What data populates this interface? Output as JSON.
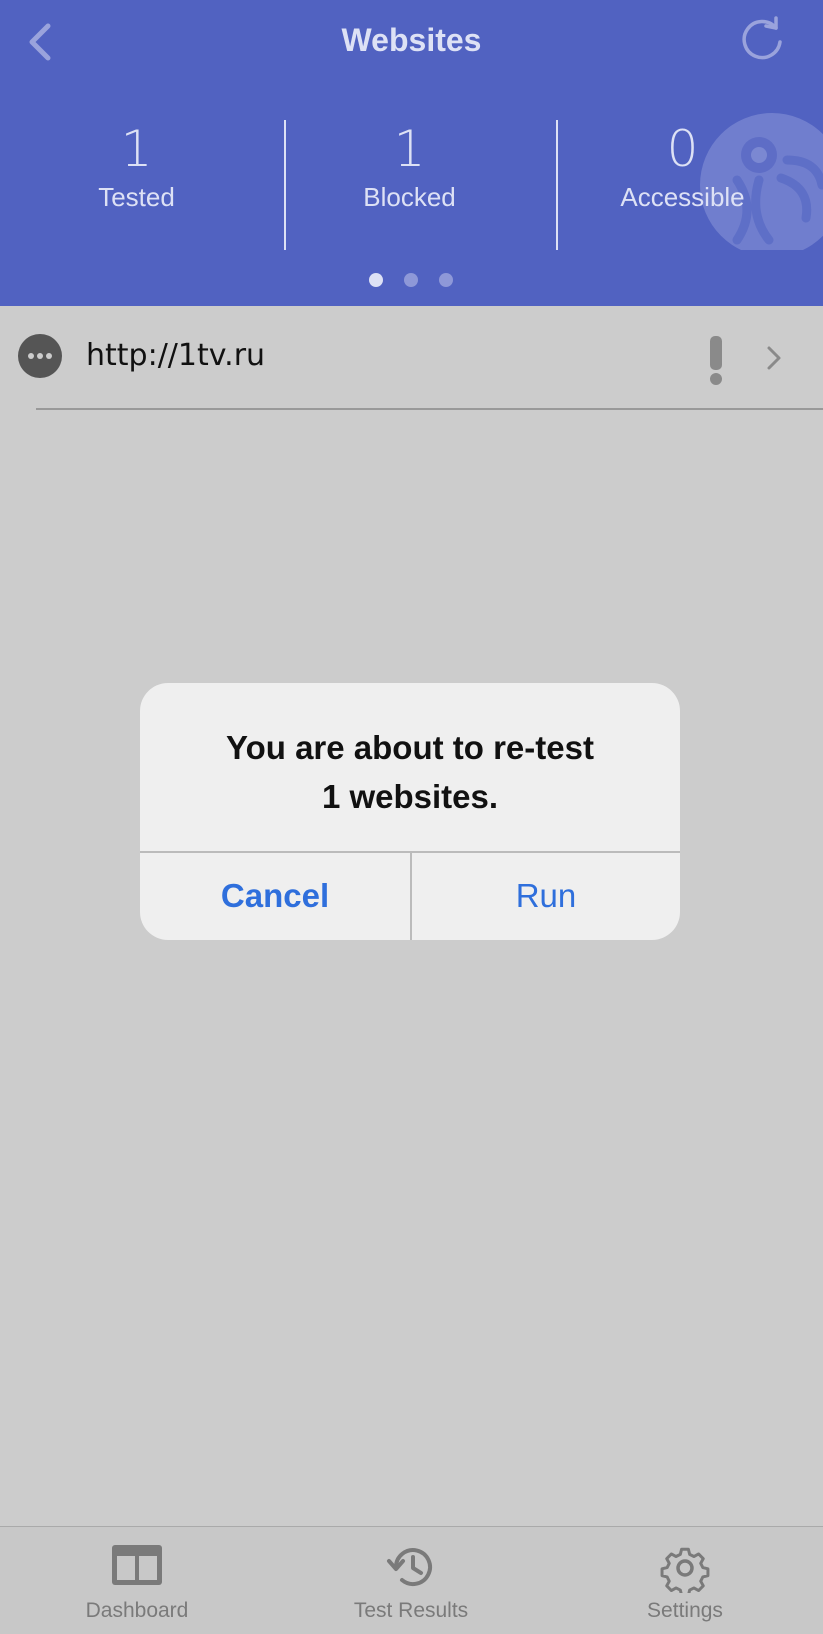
{
  "nav": {
    "title": "Websites"
  },
  "stats": [
    {
      "value": "1",
      "label": "Tested"
    },
    {
      "value": "1",
      "label": "Blocked"
    },
    {
      "value": "0",
      "label": "Accessible"
    }
  ],
  "pager": {
    "count": 3,
    "active": 0
  },
  "list": [
    {
      "url": "http://1tv.ru",
      "status": "blocked",
      "icon": "more-dots-icon"
    }
  ],
  "dialog": {
    "line1": "You are about to re-test",
    "line2": "1 websites.",
    "cancel_label": "Cancel",
    "run_label": "Run"
  },
  "tabbar": {
    "items": [
      {
        "label": "Dashboard",
        "icon": "dashboard-icon"
      },
      {
        "label": "Test Results",
        "icon": "history-icon"
      },
      {
        "label": "Settings",
        "icon": "gear-icon"
      }
    ]
  },
  "colors": {
    "header": "#5162c1",
    "overlay": "#cccccc",
    "dialog_button": "#2f6fdc"
  }
}
